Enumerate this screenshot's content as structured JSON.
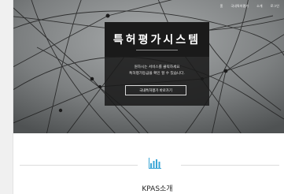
{
  "nav": {
    "items": [
      "홈",
      "국내특허평가",
      "소개",
      "로그인"
    ]
  },
  "hero": {
    "title": "특허평가시스템",
    "subtitle_line1": "원하시는 서비스를 클릭하세요",
    "subtitle_line2": "특허평가등급을 확인 할 수 있습니다.",
    "cta_label": "국내특허평가 바로가기"
  },
  "section": {
    "icon": "bar-chart-icon",
    "title": "KPAS소개"
  },
  "colors": {
    "accent": "#3aa6d6",
    "hero_box": "#1a1a1a"
  }
}
